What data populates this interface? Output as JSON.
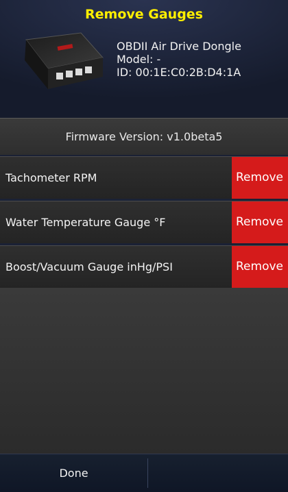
{
  "header": {
    "title": "Remove Gauges",
    "device_name": "OBDII Air Drive Dongle",
    "model_text": "Model: -",
    "id_text": "ID: 00:1E:C0:2B:D4:1A"
  },
  "firmware": {
    "text": "Firmware Version: v1.0beta5"
  },
  "gauges": [
    {
      "label": "Tachometer RPM",
      "action": "Remove"
    },
    {
      "label": "Water Temperature Gauge °F",
      "action": "Remove"
    },
    {
      "label": "Boost/Vacuum Gauge inHg/PSI",
      "action": "Remove"
    }
  ],
  "footer": {
    "done_label": "Done"
  },
  "colors": {
    "title": "#ffef00",
    "remove": "#d51b1b"
  }
}
